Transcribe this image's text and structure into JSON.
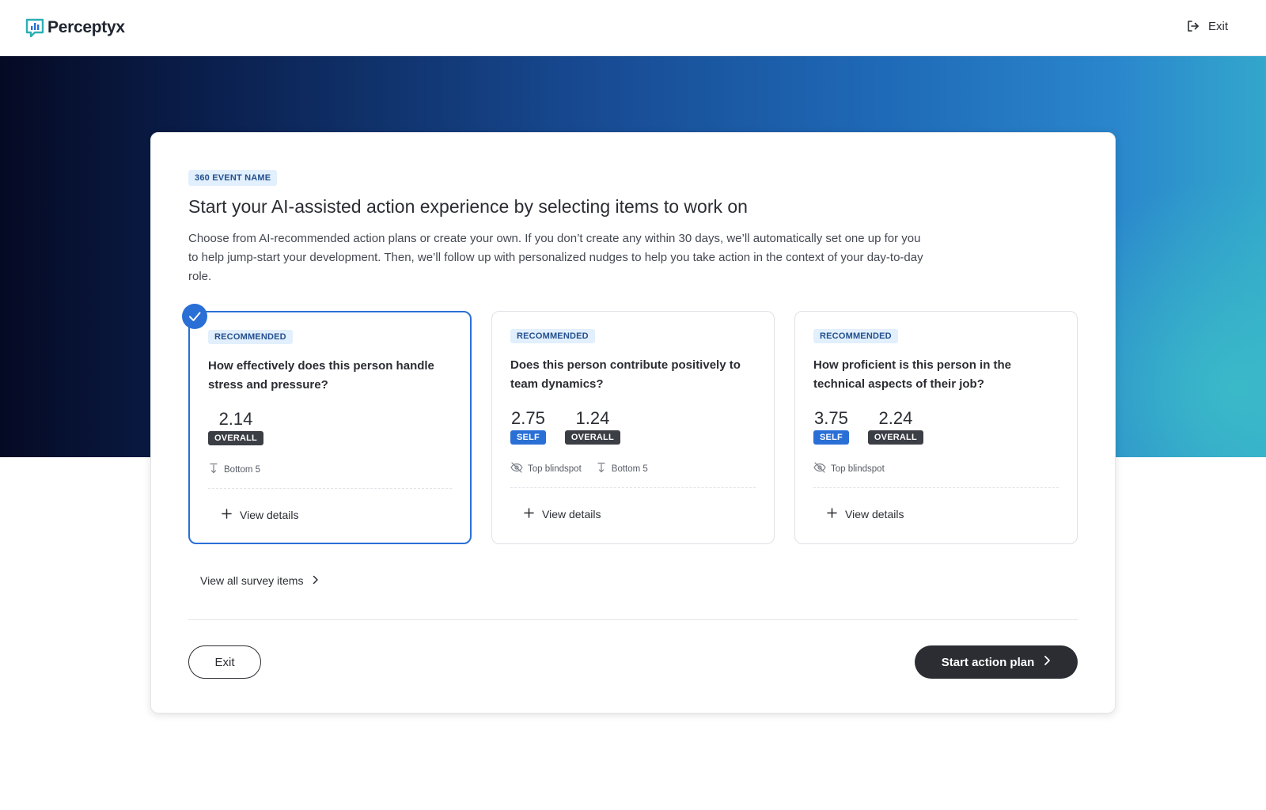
{
  "header": {
    "logo_text": "Perceptyx",
    "exit_label": "Exit"
  },
  "main": {
    "event_badge": "360 EVENT NAME",
    "headline": "Start your AI-assisted action experience by selecting items to work on",
    "intro": "Choose from AI-recommended action plans or create your own. If you don’t create any within 30 days, we’ll automatically set one up for you to help jump-start your development. Then, we’ll follow up with personalized nudges to help you take action in the context of your day-to-day role.",
    "items": [
      {
        "badge": "RECOMMENDED",
        "question": "How effectively does this person handle stress and pressure?",
        "selected": true,
        "scores": {
          "overall": "2.14",
          "overall_label": "OVERALL"
        },
        "tags": {
          "bottom": "Bottom 5"
        },
        "details_label": "View details"
      },
      {
        "badge": "RECOMMENDED",
        "question": "Does this person contribute positively to team dynamics?",
        "selected": false,
        "scores": {
          "self": "2.75",
          "self_label": "SELF",
          "overall": "1.24",
          "overall_label": "OVERALL"
        },
        "tags": {
          "blindspot": "Top blindspot",
          "bottom": "Bottom 5"
        },
        "details_label": "View details"
      },
      {
        "badge": "RECOMMENDED",
        "question": "How proficient is this person in the technical aspects of their job?",
        "selected": false,
        "scores": {
          "self": "3.75",
          "self_label": "SELF",
          "overall": "2.24",
          "overall_label": "OVERALL"
        },
        "tags": {
          "blindspot": "Top blindspot"
        },
        "details_label": "View details"
      }
    ],
    "view_all_label": "View all survey items"
  },
  "footer": {
    "exit_label": "Exit",
    "start_label": "Start action plan"
  },
  "colors": {
    "accent": "#2a6fd6",
    "dark": "#2b2d33",
    "badge_bg": "#e2effc"
  }
}
